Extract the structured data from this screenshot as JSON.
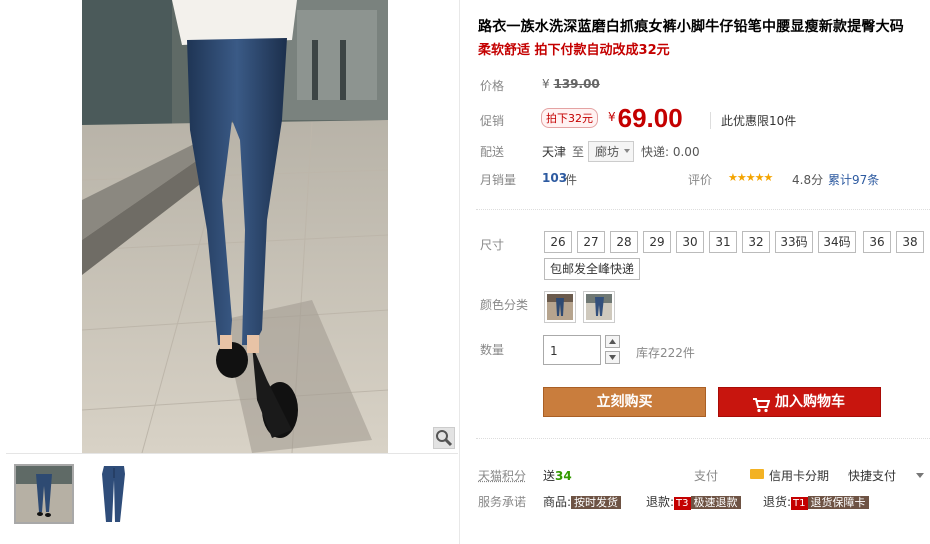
{
  "product": {
    "title": "路衣一族水洗深蓝磨白抓痕女裤小脚牛仔铅笔中腰显瘦新款提臀大码",
    "subtitle": "柔软舒适 拍下付款自动改成32元"
  },
  "price": {
    "label": "价格",
    "currency": "¥",
    "original": "139.00"
  },
  "promo": {
    "label": "促销",
    "badge": "拍下32元",
    "currency": "¥",
    "price": "69.00",
    "note": "此优惠限10件"
  },
  "shipping": {
    "label": "配送",
    "from": "天津",
    "to_word": "至",
    "destination": "廊坊",
    "fee": "快递: 0.00"
  },
  "sales": {
    "label": "月销量",
    "count": "103",
    "unit": "件"
  },
  "rating": {
    "label": "评价",
    "stars": "★★★★★",
    "score": "4.8分",
    "reviews": "累计97条",
    "value": 4.8
  },
  "size": {
    "label": "尺寸",
    "options": [
      "26",
      "27",
      "28",
      "29",
      "30",
      "31",
      "32",
      "33码",
      "34码",
      "36",
      "38"
    ],
    "extra": "包邮发全峰快递"
  },
  "color": {
    "label": "颜色分类"
  },
  "quantity": {
    "label": "数量",
    "value": "1",
    "stock": "库存222件"
  },
  "actions": {
    "buy_now": "立刻购买",
    "add_to_cart": "加入购物车"
  },
  "points": {
    "label": "天猫积分",
    "prefix": "送",
    "amount": "34"
  },
  "payment": {
    "label": "支付",
    "credit_card": "信用卡分期",
    "fast_pay": "快捷支付"
  },
  "service": {
    "label": "服务承诺",
    "goods_prefix": "商品:",
    "goods_tag": "按时发货",
    "refund_prefix": "退款:",
    "refund_code": "T3",
    "refund_tag": "极速退款",
    "return_prefix": "退货:",
    "return_code": "T1",
    "return_tag": "退货保障卡"
  },
  "colors": {
    "accent_red": "#c40000",
    "buy_orange": "#c97d3d",
    "cart_red": "#c8150e",
    "star_gold": "#f4a400",
    "link_blue": "#2d5aa0"
  },
  "icons": [
    "zoom-icon",
    "cart-icon",
    "credit-card-icon",
    "chevron-down-icon",
    "star-icon"
  ]
}
